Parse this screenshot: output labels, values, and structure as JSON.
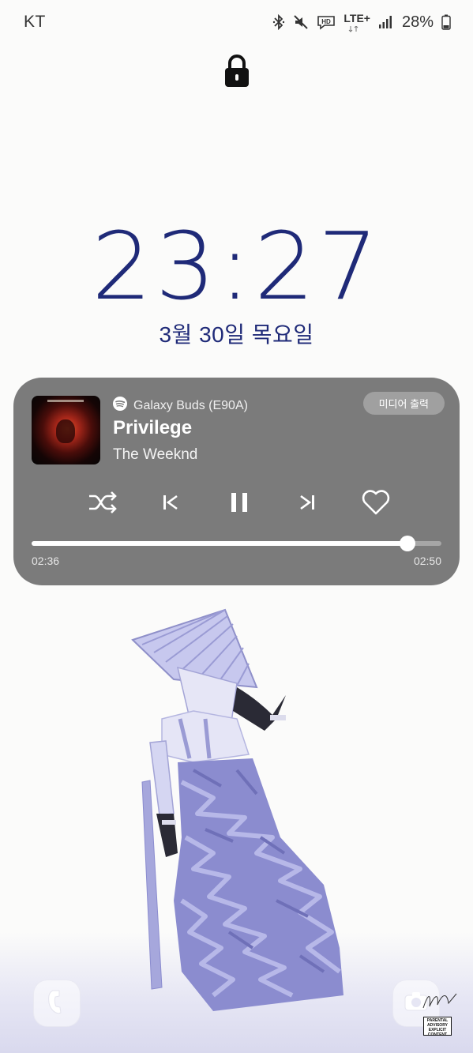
{
  "status_bar": {
    "carrier": "KT",
    "network": "LTE+",
    "battery": "28%",
    "icons": [
      "bluetooth-icon",
      "mute-icon",
      "hd-voice-icon",
      "lte-icon",
      "signal-icon",
      "battery-icon"
    ]
  },
  "lock_screen": {
    "time": "23:27",
    "date": "3월 30일 목요일"
  },
  "media_player": {
    "source_device": "Galaxy Buds (E90A)",
    "output_button": "미디어 출력",
    "track_title": "Privilege",
    "artist": "The Weeknd",
    "elapsed": "02:36",
    "duration": "02:50",
    "progress": 0.918,
    "is_playing": true,
    "controls": [
      "shuffle-icon",
      "previous-icon",
      "pause-icon",
      "next-icon",
      "heart-icon"
    ]
  },
  "shortcuts": {
    "left": "phone-icon",
    "right": "camera-icon"
  },
  "wallpaper": {
    "advisory_label": "PARENTAL ADVISORY EXPLICIT CONTENT",
    "signature": "JSW"
  },
  "colors": {
    "clock": "#1f2a78",
    "card": "#7b7b7b",
    "figure": "#8b8ccf"
  }
}
